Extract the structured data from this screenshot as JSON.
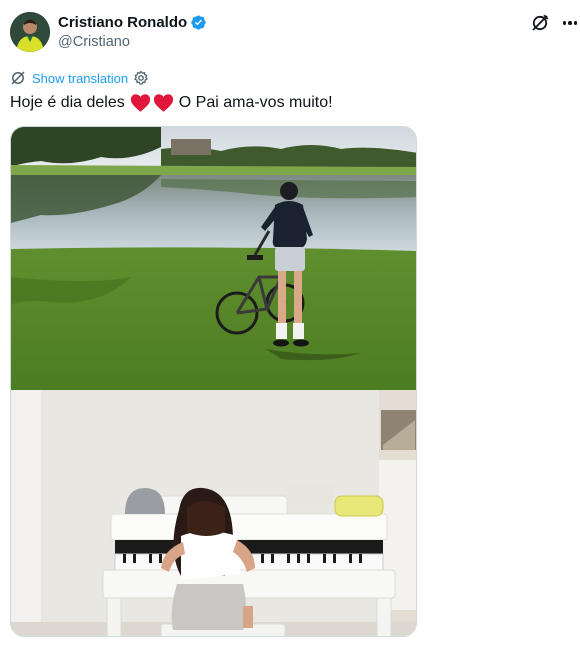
{
  "author": {
    "display_name": "Cristiano Ronaldo",
    "handle": "@Cristiano",
    "verified": true
  },
  "translate": {
    "label": "Show translation"
  },
  "tweet": {
    "text_before": "Hoje é dia deles",
    "emoji": "❤️❤️",
    "text_after": "O Pai ama-vos muito!"
  },
  "media": [
    {
      "name": "photo-boy-with-bicycle-by-lake",
      "icon": "photo"
    },
    {
      "name": "photo-girl-playing-white-piano",
      "icon": "photo"
    }
  ],
  "colors": {
    "link": "#1d9bf0",
    "verified": "#1d9bf0",
    "heart": "#e0173b",
    "text": "#0f1419",
    "secondary": "#536471"
  }
}
